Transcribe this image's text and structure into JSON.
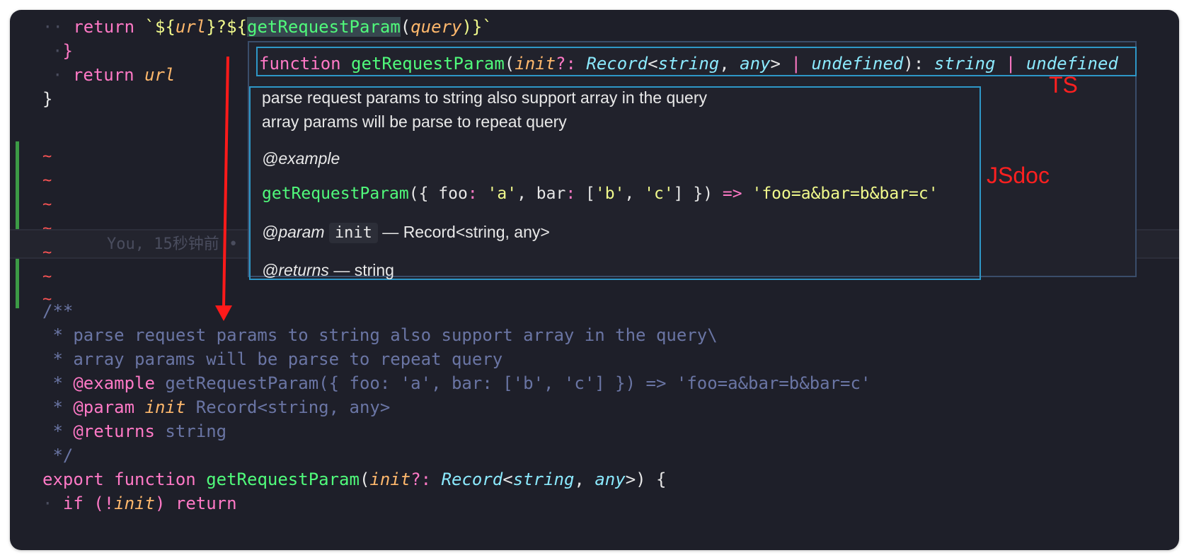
{
  "code_top": {
    "line1": {
      "kw_return": "return",
      "tpl_open": "`${",
      "url": "url",
      "mid": "}?${",
      "fn": "getRequestParam",
      "paren_open": "(",
      "arg": "query",
      "paren_close": ")}`"
    },
    "line2": "}",
    "line3": {
      "kw_return": "return",
      "url": "url"
    },
    "line4": "}"
  },
  "blame": "You, 15秒钟前 •",
  "hover": {
    "sig": {
      "kw": "function",
      "fn": "getRequestParam",
      "p1": "(",
      "param": "init",
      "q": "?: ",
      "rec": "Record",
      "lt": "<",
      "str": "string",
      "comma": ", ",
      "any": "any",
      "gt": "> ",
      "pipe1": "|",
      "undef1": " undefined",
      "close": "): ",
      "ret": "string",
      "pipe2": " | ",
      "undef2": "undefined"
    },
    "desc1": "parse request params to string also support array in the query",
    "desc2": "array params will be parse to repeat query",
    "example_tag": "@example",
    "example": {
      "fn": "getRequestParam",
      "a": "({ foo",
      "colon1": ":",
      "v1": " 'a'",
      "b": ", bar",
      "colon2": ":",
      "c": " [",
      "v2": "'b'",
      "d": ", ",
      "v3": "'c'",
      "e": "] }) ",
      "arrow": "=>",
      "result": " 'foo=a&bar=b&bar=c'"
    },
    "param_tag": "@param",
    "param_name": "init",
    "param_desc": " — Record<string, any>",
    "returns_tag": "@returns",
    "returns_desc": " — string"
  },
  "labels": {
    "ts": "TS",
    "jsdoc": "JSdoc"
  },
  "comment": {
    "open": "/**",
    "l1": " * parse request params to string also support array in the query\\",
    "l2": " * array params will be parse to repeat query",
    "l3_tag": "@example",
    "l3_rest": " getRequestParam({ foo: 'a', bar: ['b', 'c'] }) => 'foo=a&bar=b&bar=c'",
    "l4_tag": "@param",
    "l4_name": " init",
    "l4_rest": " Record<string, any>",
    "l5_tag": "@returns",
    "l5_rest": " string",
    "close": " */"
  },
  "code_bottom": {
    "export": "export",
    "function": "function",
    "fn": "getRequestParam",
    "p1": "(",
    "init": "init",
    "q": "?: ",
    "rec": "Record",
    "lt": "<",
    "str": "string",
    "comma": ", ",
    "any": "any",
    "gt": ">",
    "end": ") {",
    "if_kw": "if",
    "if_open": " (!",
    "if_init": "init",
    "if_close": ") ",
    "ret_kw": "return"
  },
  "colors": {
    "annotation": "#ff2020",
    "box": "#2e97c7",
    "diff_added": "#3c9b46"
  }
}
